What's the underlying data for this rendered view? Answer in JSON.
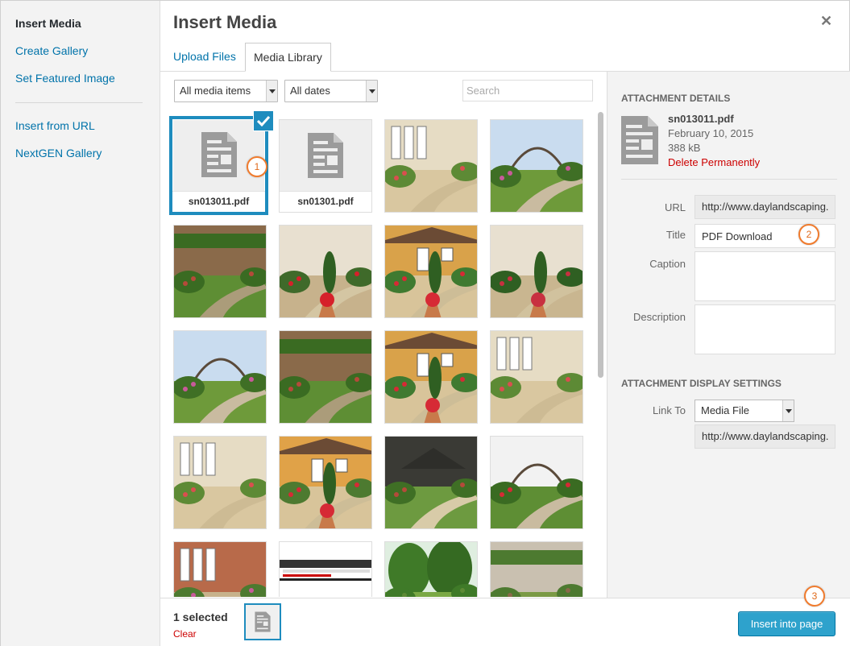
{
  "sidebar": {
    "items": [
      {
        "label": "Insert Media",
        "active": true
      },
      {
        "label": "Create Gallery"
      },
      {
        "label": "Set Featured Image"
      },
      {
        "label": "Insert from URL"
      },
      {
        "label": "NextGEN Gallery"
      }
    ]
  },
  "header": {
    "title": "Insert Media",
    "close_icon": "close-icon"
  },
  "tabs": [
    {
      "label": "Upload Files",
      "active": false
    },
    {
      "label": "Media Library",
      "active": true
    }
  ],
  "filters": {
    "type_selected": "All media items",
    "date_selected": "All dates",
    "search_placeholder": "Search"
  },
  "grid": {
    "documents": [
      {
        "filename": "sn013011.pdf",
        "selected": true
      },
      {
        "filename": "sn01301.pdf",
        "selected": false
      }
    ],
    "photo_count": 18
  },
  "callouts": [
    "1",
    "2",
    "3"
  ],
  "attachment": {
    "section_title": "ATTACHMENT DETAILS",
    "filename": "sn013011.pdf",
    "date": "February 10, 2015",
    "size": "388 kB",
    "delete_label": "Delete Permanently",
    "fields": {
      "url_label": "URL",
      "url_value": "http://www.daylandscaping.",
      "title_label": "Title",
      "title_value": "PDF Download",
      "caption_label": "Caption",
      "caption_value": "",
      "description_label": "Description",
      "description_value": ""
    }
  },
  "display_settings": {
    "section_title": "ATTACHMENT DISPLAY SETTINGS",
    "link_to_label": "Link To",
    "link_to_selected": "Media File",
    "link_url": "http://www.daylandscaping."
  },
  "footer": {
    "selected_count": "1 selected",
    "clear_label": "Clear",
    "insert_label": "Insert into page"
  },
  "colors": {
    "accent": "#1e8cbe",
    "button": "#2ea2cc",
    "link": "#0073aa",
    "delete": "#cc0000",
    "callout": "#f07b2d"
  }
}
